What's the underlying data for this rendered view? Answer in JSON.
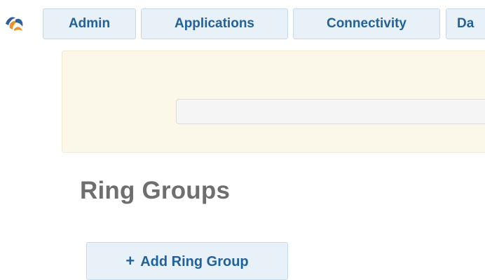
{
  "nav": {
    "tabs": [
      {
        "label": "Admin"
      },
      {
        "label": "Applications"
      },
      {
        "label": "Connectivity"
      },
      {
        "label": "Da"
      }
    ]
  },
  "notice": {
    "input_value": ""
  },
  "page": {
    "title": "Ring Groups"
  },
  "actions": {
    "add_label": "Add Ring Group",
    "add_icon": "plus-icon"
  },
  "colors": {
    "accent": "#22619a",
    "tab_background": "#e8f1f8",
    "notice_background": "#fcf8e9",
    "title_gray": "#6e6e6e"
  }
}
